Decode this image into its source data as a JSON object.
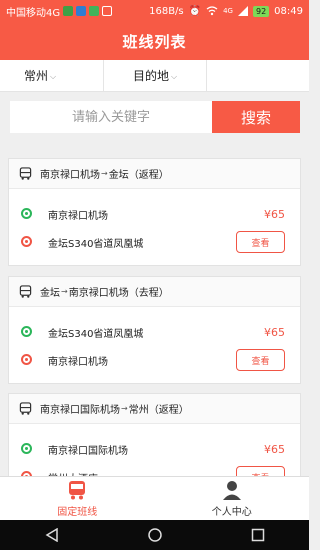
{
  "status_bar": {
    "carrier": "中国移动4G",
    "speed": "168B/s",
    "network": "4G",
    "battery": "92",
    "time": "08:49"
  },
  "header": {
    "title": "班线列表"
  },
  "filters": {
    "city": "常州",
    "destination": "目的地"
  },
  "search": {
    "placeholder": "请输入关键字",
    "button_label": "搜索"
  },
  "routes": [
    {
      "title_from": "南京禄口机场",
      "title_to": "金坛",
      "direction": "（返程）",
      "start": "南京禄口机场",
      "end": "金坛S340省道凤凰城",
      "price": "¥65",
      "button": "查看"
    },
    {
      "title_from": "金坛",
      "title_to": "南京禄口机场",
      "direction": "（去程）",
      "start": "金坛S340省道凤凰城",
      "end": "南京禄口机场",
      "price": "¥65",
      "button": "查看"
    },
    {
      "title_from": "南京禄口国际机场",
      "title_to": "常州",
      "direction": "（返程）",
      "start": "南京禄口国际机场",
      "end": "常州大酒店",
      "price": "¥65",
      "button": "查看"
    }
  ],
  "tabs": [
    {
      "label": "固定班线",
      "icon": "bus-icon",
      "active": true
    },
    {
      "label": "个人中心",
      "icon": "user-icon",
      "active": false
    }
  ],
  "colors": {
    "brand": "#f75a45",
    "start_stop": "#2bb65a",
    "end_stop": "#f05545"
  }
}
